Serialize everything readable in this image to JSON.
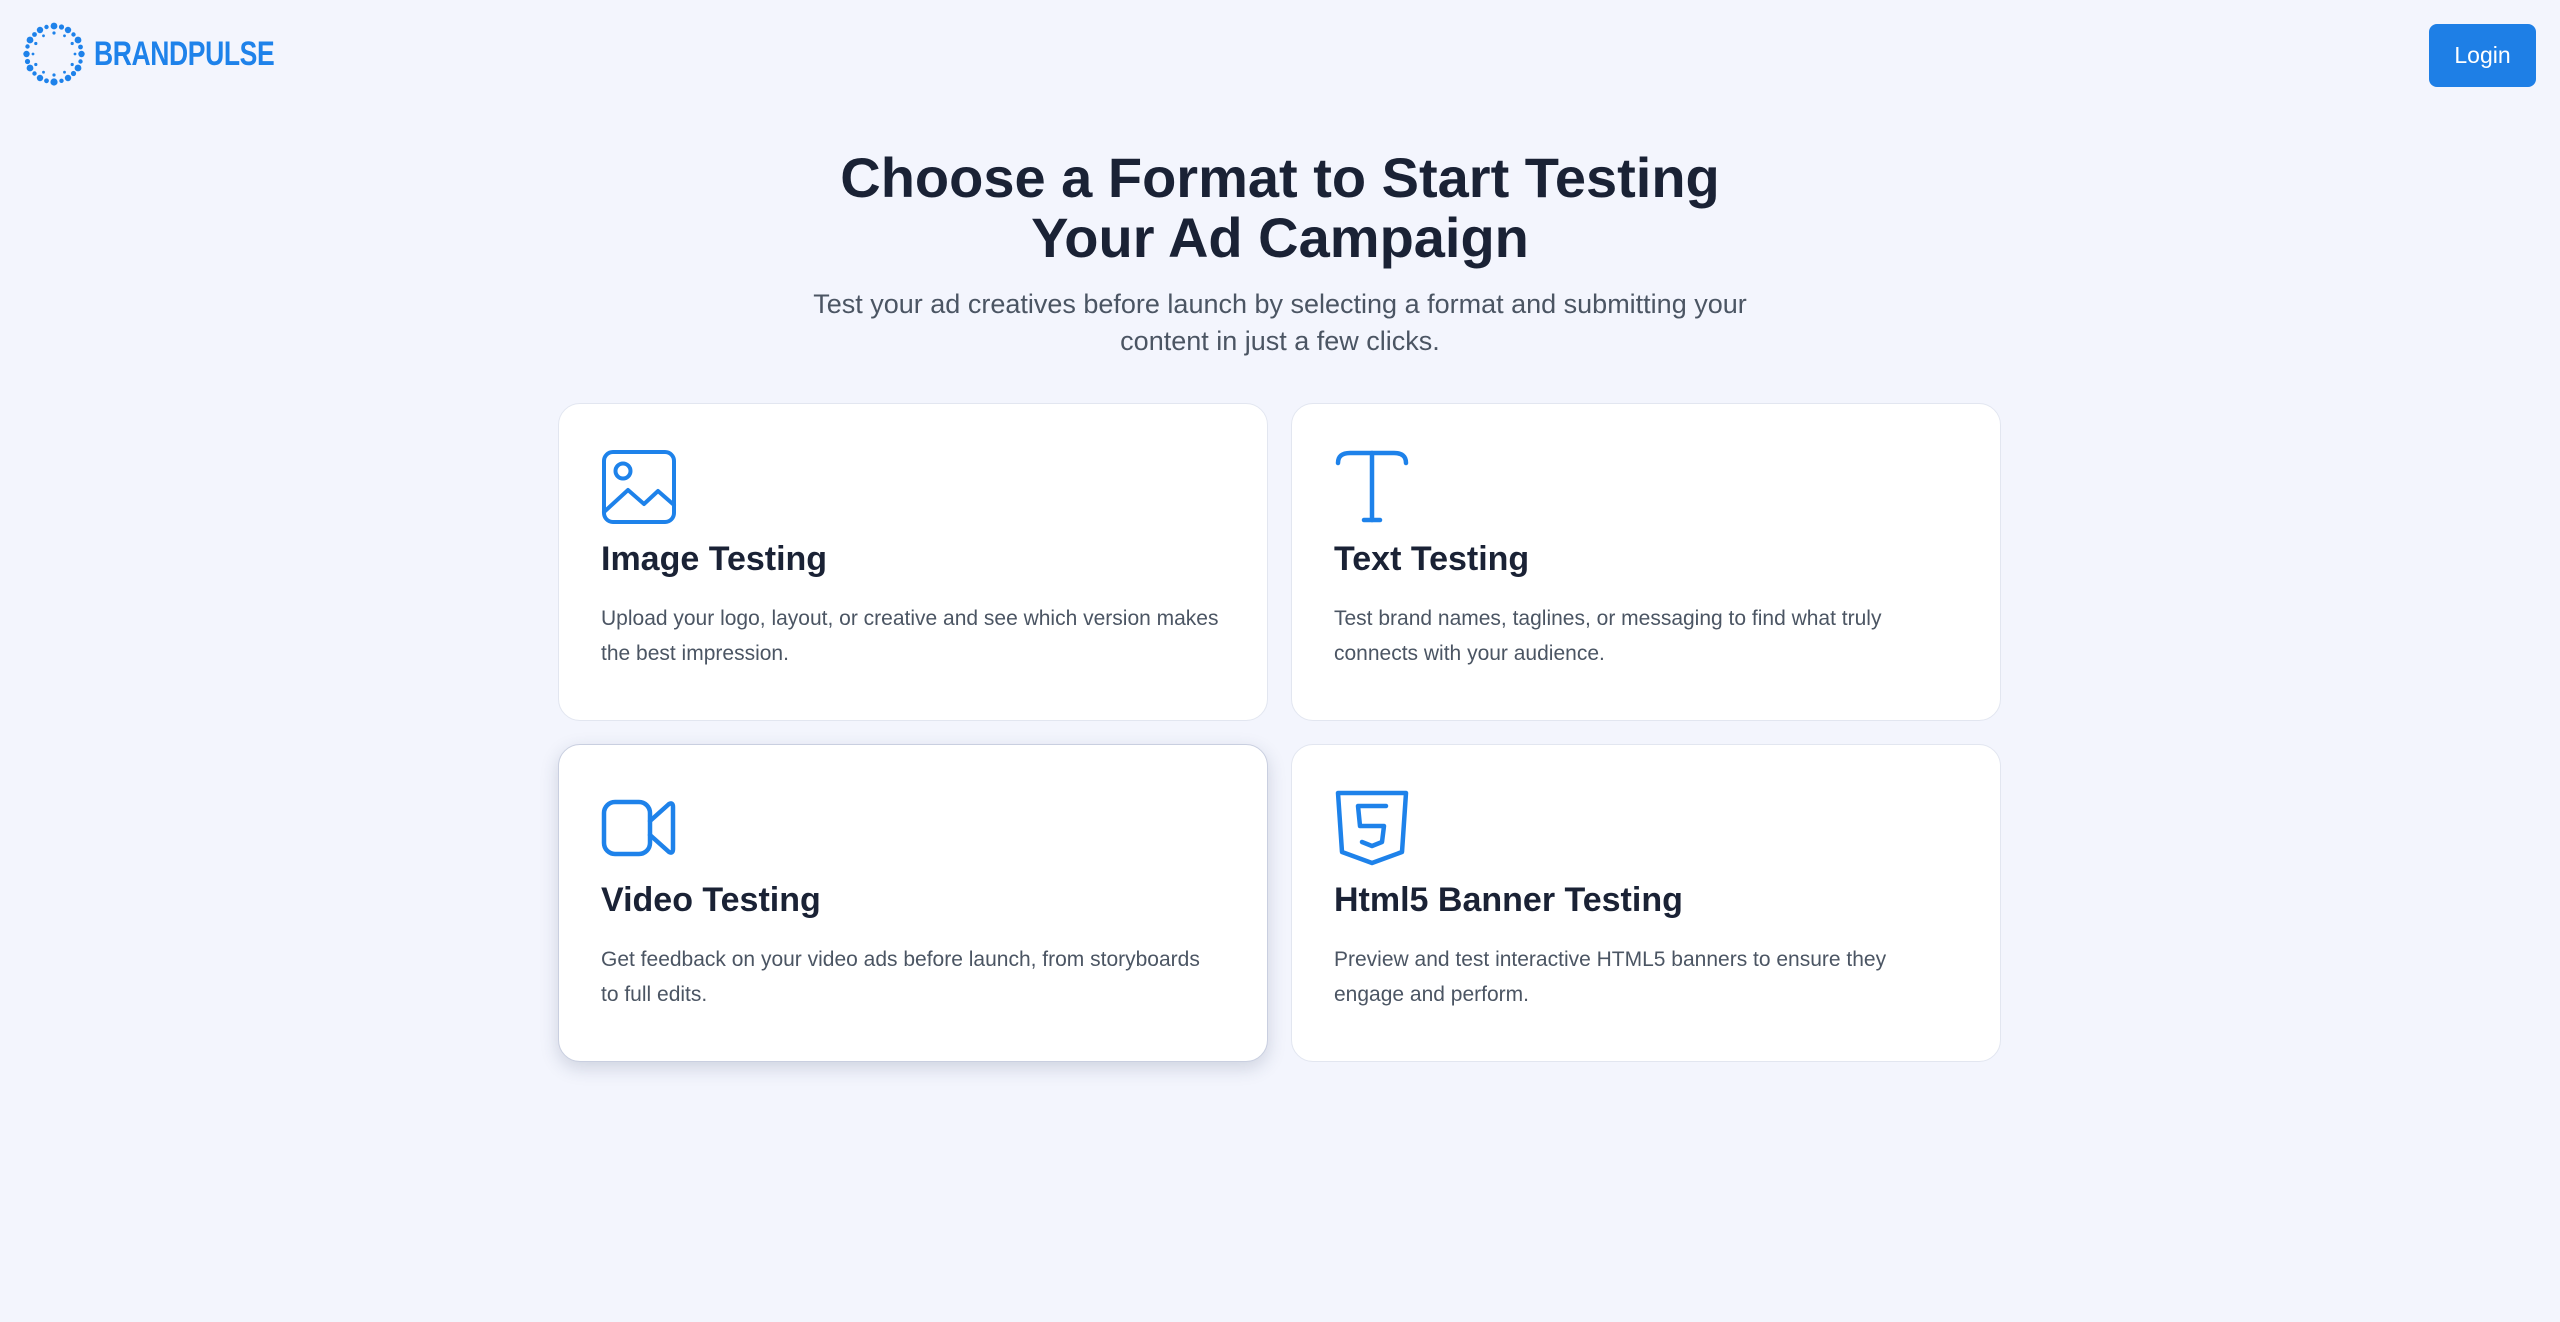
{
  "header": {
    "brand_name": "BRANDPULSE",
    "login_label": "Login"
  },
  "hero": {
    "title": "Choose a Format to Start Testing Your Ad Campaign",
    "subtitle": "Test your ad creatives before launch by selecting a format and submitting your content in just a few clicks."
  },
  "formats": [
    {
      "icon": "image-icon",
      "title": "Image Testing",
      "description": "Upload your logo, layout, or creative and see which version makes the best impression."
    },
    {
      "icon": "text-type-icon",
      "title": "Text Testing",
      "description": "Test brand names, taglines, or messaging to find what truly connects with your audience."
    },
    {
      "icon": "video-camera-icon",
      "title": "Video Testing",
      "description": "Get feedback on your video ads before launch, from storyboards to full edits."
    },
    {
      "icon": "html5-icon",
      "title": "Html5 Banner Testing",
      "description": "Preview and test interactive HTML5 banners to ensure they engage and perform."
    }
  ],
  "colors": {
    "background": "#f3f5fd",
    "accent": "#1e82ea",
    "title_text": "#1a2235",
    "body_text": "#4b5563"
  }
}
